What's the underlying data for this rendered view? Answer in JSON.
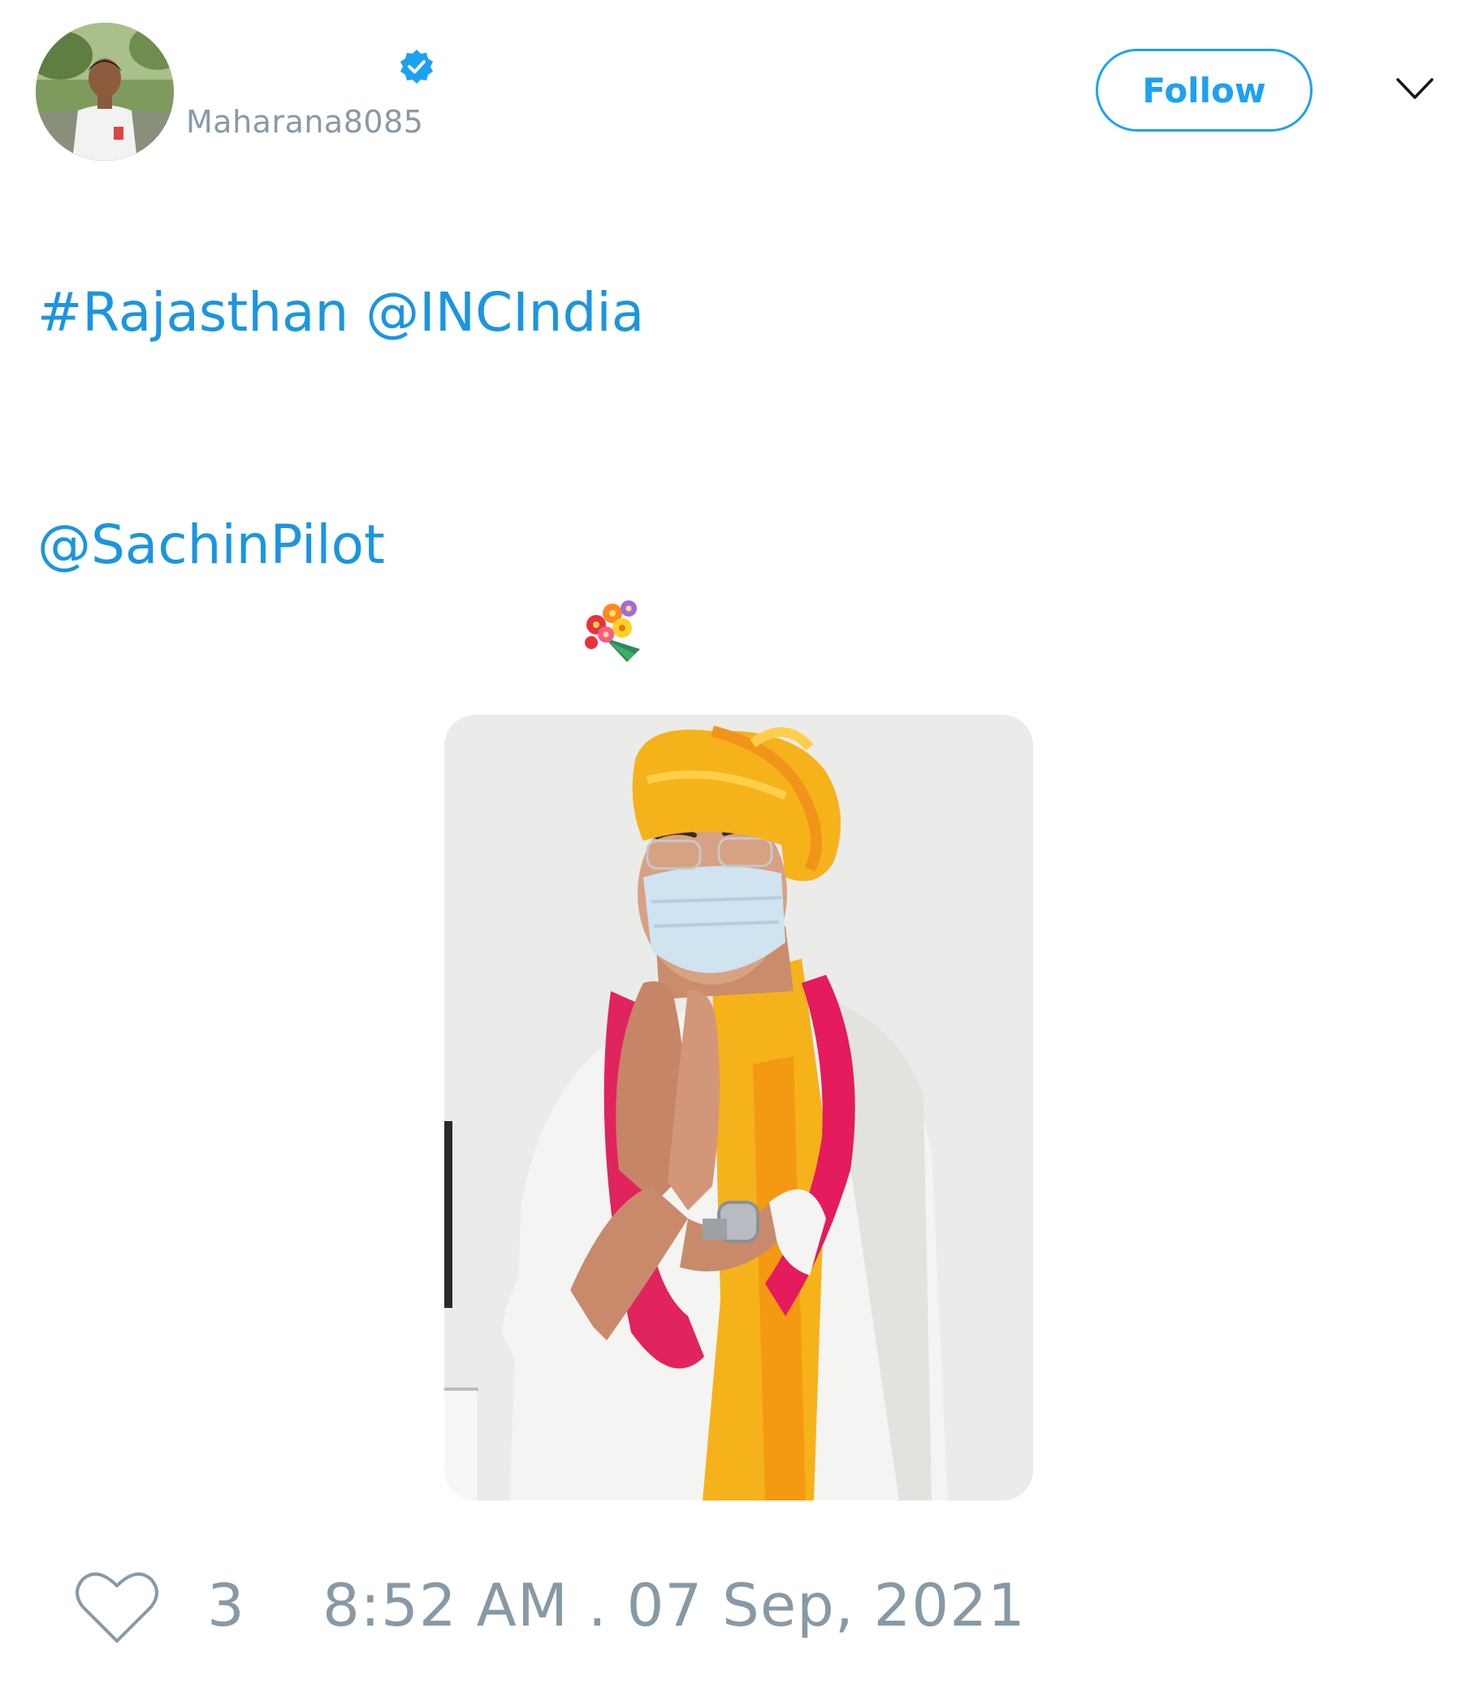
{
  "tweet": {
    "author": {
      "display_name": "",
      "handle": "Maharana8085",
      "verified": true,
      "avatar_icon": "user-avatar-photo"
    },
    "follow_label": "Follow",
    "menu_icon": "chevron-down-icon",
    "text": {
      "line1_hashtag": "#Rajasthan",
      "line1_mention": "@INCIndia",
      "line2_mention": "@SachinPilot",
      "emoji": "💐"
    },
    "media": {
      "icon": "photo-man-turban-namaste"
    },
    "footer": {
      "like_icon": "heart-icon",
      "like_count": "3",
      "timestamp": "8:52 AM . 07 Sep, 2021"
    }
  },
  "colors": {
    "link": "#1b95e0",
    "brand": "#1da1f2",
    "muted": "#8899a6",
    "text": "#14171a",
    "background": "#ffffff"
  }
}
